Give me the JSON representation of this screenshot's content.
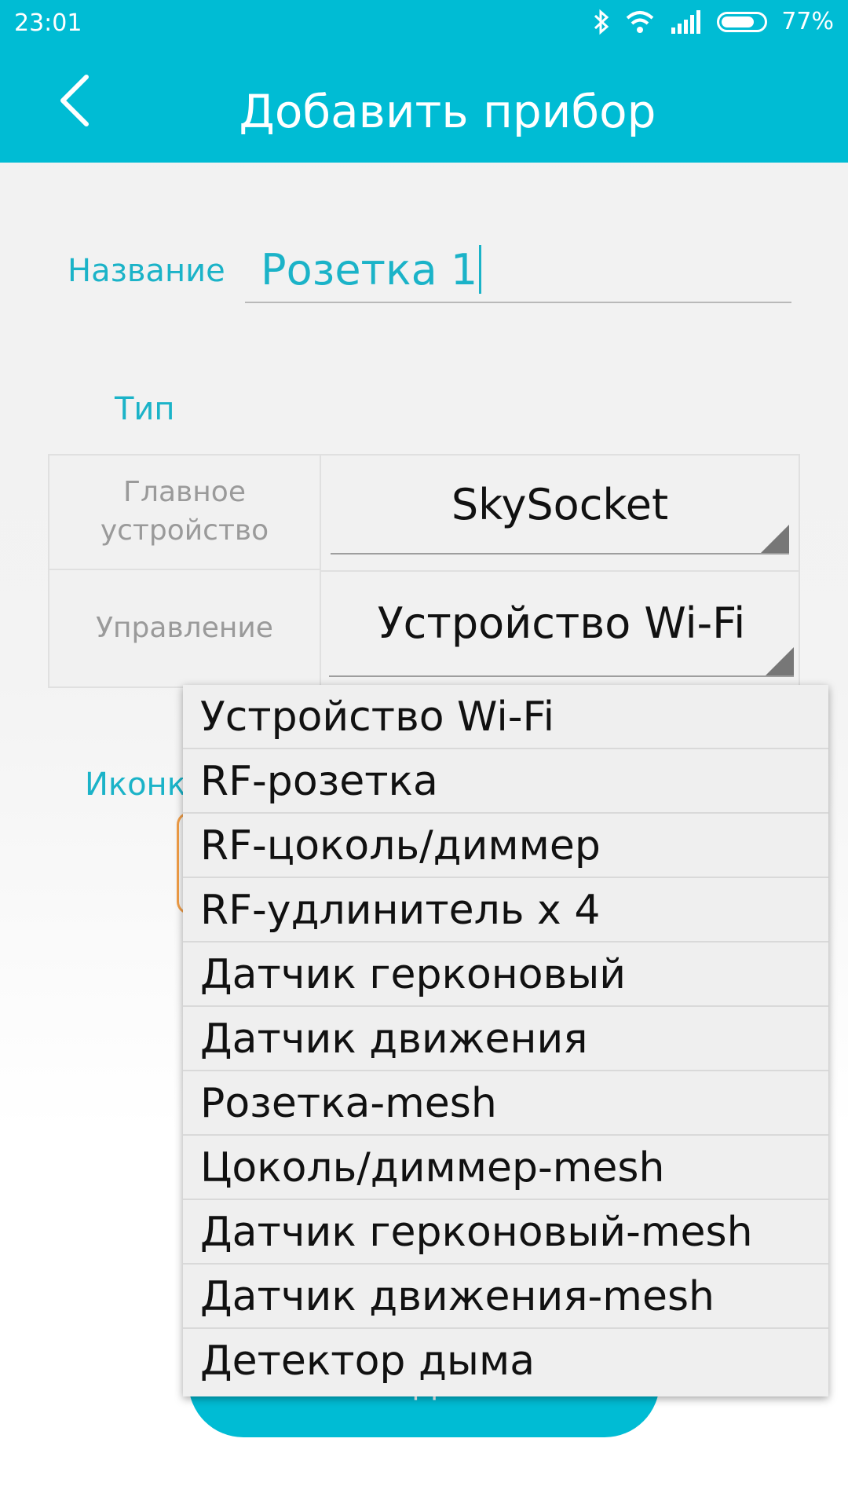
{
  "status_bar": {
    "time": "23:01",
    "battery": "77%"
  },
  "header": {
    "title": "Добавить прибор"
  },
  "form": {
    "name_label": "Название",
    "name_value": "Розетка 1",
    "type_label": "Тип",
    "rows": [
      {
        "label": "Главное\nустройство",
        "value": "SkySocket"
      },
      {
        "label": "Управление",
        "value": "Устройство Wi-Fi"
      }
    ],
    "icon_label": "Иконк",
    "submit_label": "Создать"
  },
  "dropdown": {
    "options": [
      "Устройство Wi-Fi",
      "RF-розетка",
      "RF-цоколь/диммер",
      "RF-удлинитель х 4",
      "Датчик герконовый",
      "Датчик движения",
      "Розетка-mesh",
      "Цоколь/диммер-mesh",
      "Датчик герконовый-mesh",
      "Датчик движения-mesh",
      "Детектор дыма"
    ]
  },
  "colors": {
    "accent": "#00bcd4",
    "label": "#1bb3c8",
    "icon_border": "#f29e47"
  }
}
